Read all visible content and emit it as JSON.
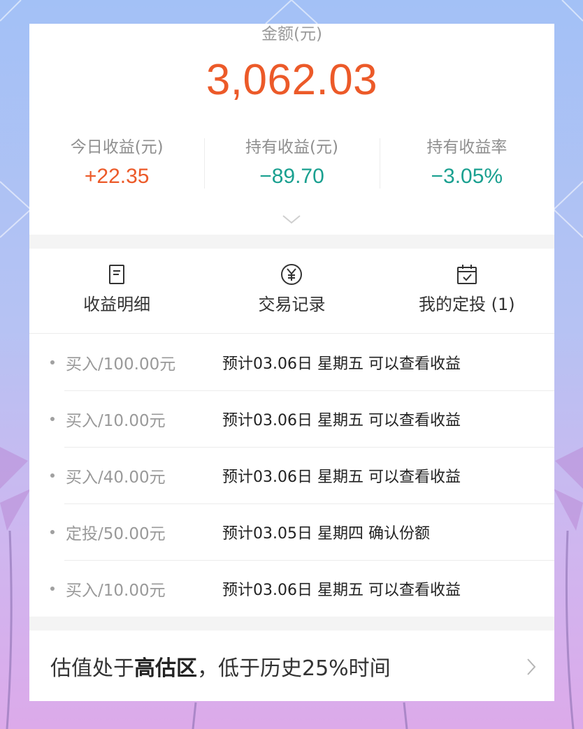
{
  "summary": {
    "amount_label": "金额(元)",
    "amount_value": "3,062.03",
    "stats": [
      {
        "label": "今日收益(元)",
        "value": "+22.35"
      },
      {
        "label": "持有收益(元)",
        "value": "−89.70"
      },
      {
        "label": "持有收益率",
        "value": "−3.05%"
      }
    ]
  },
  "actions": [
    {
      "label": "收益明细",
      "icon": "document-icon"
    },
    {
      "label": "交易记录",
      "icon": "yuan-circle-icon"
    },
    {
      "label": "我的定投 (1)",
      "icon": "calendar-check-icon"
    }
  ],
  "transactions": [
    {
      "type": "买入/100.00元",
      "note": "预计03.06日 星期五 可以查看收益"
    },
    {
      "type": "买入/10.00元",
      "note": "预计03.06日 星期五 可以查看收益"
    },
    {
      "type": "买入/40.00元",
      "note": "预计03.06日 星期五 可以查看收益"
    },
    {
      "type": "定投/50.00元",
      "note": "预计03.05日 星期四 确认份额"
    },
    {
      "type": "买入/10.00元",
      "note": "预计03.06日 星期五 可以查看收益"
    }
  ],
  "valuation": {
    "prefix": "估值处于",
    "highlight": "高估区",
    "suffix": "，低于历史25%时间"
  },
  "colors": {
    "positive": "#ec5a29",
    "negative": "#1aa090"
  }
}
